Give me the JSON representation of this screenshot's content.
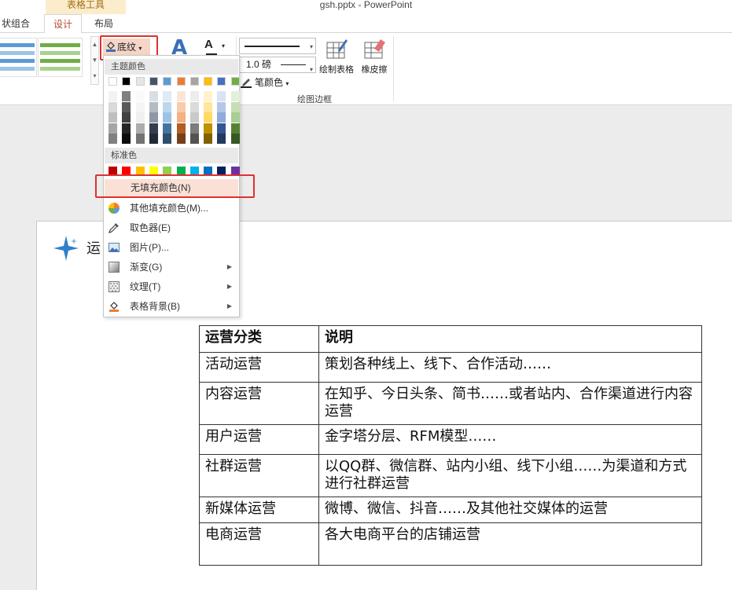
{
  "window": {
    "title": "gsh.pptx - PowerPoint",
    "context_tab_group": "表格工具"
  },
  "tabs": {
    "arrange": "状组合",
    "design": "设计",
    "layout": "布局"
  },
  "ribbon": {
    "shading_label": "底纹",
    "pen_weight": "1.0 磅",
    "pen_color": "笔颜色",
    "draw_table": "绘制表格",
    "eraser": "橡皮擦",
    "draw_borders_group": "绘图边框",
    "text_fill_letter": "A",
    "wordart_letter": "A"
  },
  "shading_menu": {
    "theme_colors_header": "主题颜色",
    "standard_colors_header": "标准色",
    "no_fill": "无填充颜色(N)",
    "more_colors": "其他填充颜色(M)...",
    "more_colors_key": "M",
    "eyedropper": "取色器(E)",
    "eyedropper_key": "E",
    "picture": "图片(P)...",
    "picture_key": "P",
    "gradient": "渐变(G)",
    "gradient_key": "G",
    "texture": "纹理(T)",
    "texture_key": "T",
    "table_background": "表格背景(B)",
    "table_background_key": "B",
    "theme_colors": [
      "#ffffff",
      "#000000",
      "#e7e6e6",
      "#44546a",
      "#5b9bd5",
      "#ed7d31",
      "#a5a5a5",
      "#ffc000",
      "#4472c4",
      "#70ad47"
    ],
    "standard_colors": [
      "#c00000",
      "#ff0000",
      "#ffc000",
      "#ffff00",
      "#92d050",
      "#00b050",
      "#00b0f0",
      "#0070c0",
      "#002060",
      "#7030a0"
    ]
  },
  "slide": {
    "title": "运",
    "table": {
      "headers": [
        "运营分类",
        "说明"
      ],
      "rows": [
        [
          "活动运营",
          "策划各种线上、线下、合作活动……"
        ],
        [
          "内容运营",
          "在知乎、今日头条、简书……或者站内、合作渠道进行内容运营"
        ],
        [
          "用户运营",
          "金字塔分层、RFM模型……"
        ],
        [
          "社群运营",
          "以QQ群、微信群、站内小组、线下小组……为渠道和方式进行社群运营"
        ],
        [
          "新媒体运营",
          "微博、微信、抖音……及其他社交媒体的运营"
        ],
        [
          "电商运营",
          "各大电商平台的店铺运营"
        ]
      ]
    }
  },
  "colors": {
    "accent": "#b7472a",
    "highlight_red": "#e03030",
    "hover_bg": "#fbe0d6"
  }
}
